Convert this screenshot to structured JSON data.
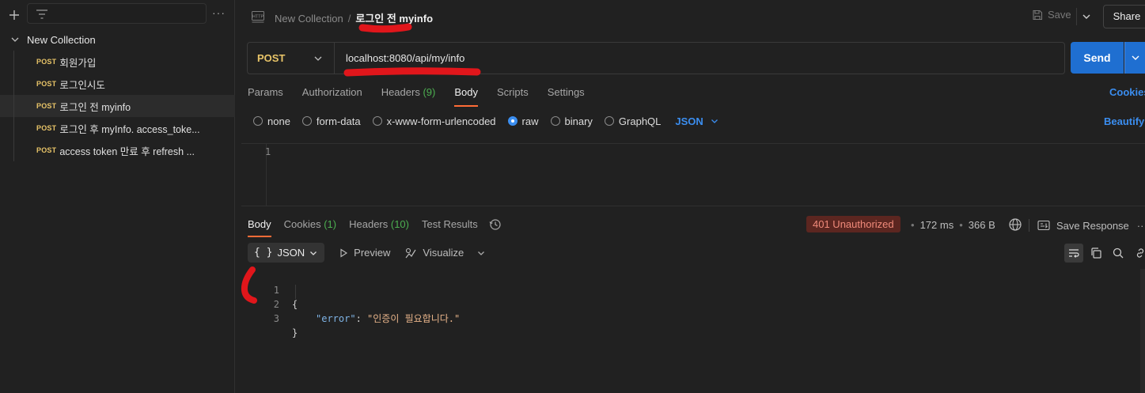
{
  "sidebar": {
    "collection_name": "New Collection",
    "items": [
      {
        "method": "POST",
        "name": "회원가입",
        "active": false
      },
      {
        "method": "POST",
        "name": "로그인시도",
        "active": false
      },
      {
        "method": "POST",
        "name": "로그인 전 myinfo",
        "active": true
      },
      {
        "method": "POST",
        "name": "로그인 후 myInfo. access_toke...",
        "active": false
      },
      {
        "method": "POST",
        "name": "access token 만료 후 refresh ...",
        "active": false
      }
    ]
  },
  "header": {
    "collection": "New Collection",
    "separator": "/",
    "request_name": "로그인 전 myinfo",
    "save_label": "Save",
    "share_label": "Share"
  },
  "request": {
    "method": "POST",
    "url": "localhost:8080/api/my/info",
    "send_label": "Send",
    "tabs": [
      {
        "label": "Params",
        "count": ""
      },
      {
        "label": "Authorization",
        "count": ""
      },
      {
        "label": "Headers ",
        "count": "(9)"
      },
      {
        "label": "Body",
        "count": "",
        "active": true
      },
      {
        "label": "Scripts",
        "count": ""
      },
      {
        "label": "Settings",
        "count": ""
      }
    ],
    "cookies_label": "Cookies",
    "body_types": [
      "none",
      "form-data",
      "x-www-form-urlencoded",
      "raw",
      "binary",
      "GraphQL"
    ],
    "body_type_selected": "raw",
    "language": "JSON",
    "beautify_label": "Beautify",
    "editor_line": "1"
  },
  "response": {
    "tabs": [
      {
        "label": "Body",
        "count": "",
        "active": true
      },
      {
        "label": "Cookies ",
        "count": "(1)"
      },
      {
        "label": "Headers ",
        "count": "(10)"
      },
      {
        "label": "Test Results",
        "count": ""
      }
    ],
    "status": "401 Unauthorized",
    "time": "172 ms",
    "size": "366 B",
    "save_response_label": "Save Response",
    "more": "···",
    "format": "JSON",
    "format_braces": "{ }",
    "preview_label": "Preview",
    "visualize_label": "Visualize",
    "body_lines": [
      {
        "no": "1",
        "text": "{"
      },
      {
        "no": "2",
        "key": "\"error\"",
        "colon": ": ",
        "value": "\"인증이 필요합니다.\""
      },
      {
        "no": "3",
        "text": "}"
      }
    ]
  },
  "colors": {
    "accent_orange": "#ff6c37",
    "send_blue": "#1f6fd1",
    "link_blue": "#3b8ef0",
    "method_post": "#e8c468",
    "annotation_red": "#e0161b"
  }
}
